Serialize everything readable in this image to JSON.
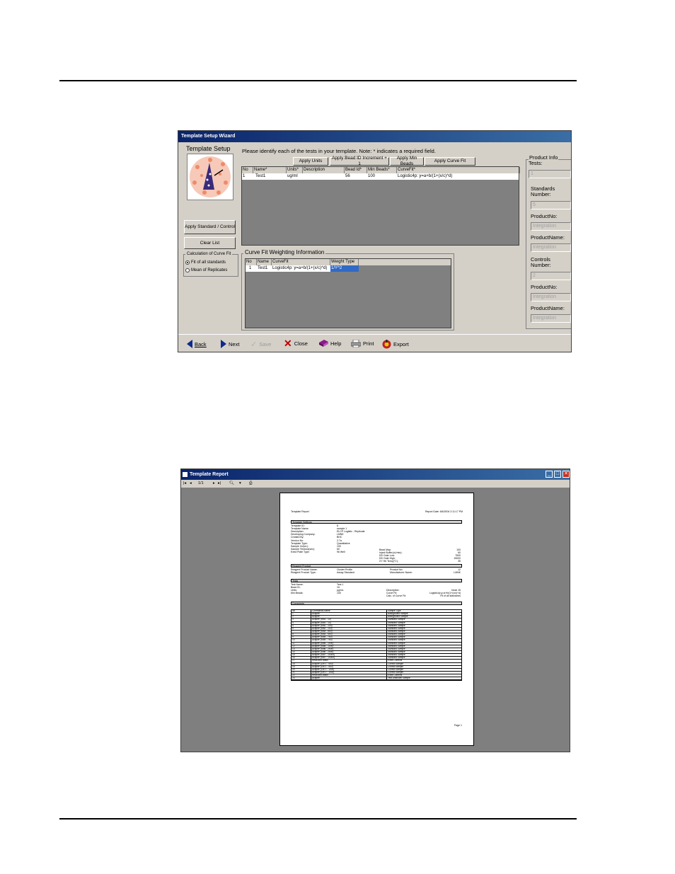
{
  "wizard": {
    "title": "Template Setup Wizard",
    "heading": "Template Setup",
    "instructions": "Please identify each of the tests in your template.  Note: * indicates a required field.",
    "buttons": {
      "apply_units": "Apply Units",
      "apply_bead_id": "Apply Bead ID Increment + 1",
      "apply_min_beads": "Apply Min Beads",
      "apply_curve_fit": "Apply Curve Fit",
      "apply_standard": "Apply Standard / Control",
      "clear_list": "Clear List"
    },
    "calc_group": {
      "label": "Calculation of Curve Fit",
      "options": [
        "Fit of all standards",
        "Mean of Replicates"
      ],
      "selected": "Fit of all standards"
    },
    "tests_grid": {
      "columns": [
        "No",
        "Name*",
        "Units*",
        "Description",
        "Bead Id*",
        "Min Beads*",
        "CurveFit*"
      ],
      "rows": [
        [
          "1",
          "Test1",
          "ug/ml",
          "",
          "56",
          "100",
          "Logistic4p: y=a+b/(1+(x/c)^d)"
        ]
      ]
    },
    "weighting": {
      "label": "Curve Fit Weighting Information",
      "columns": [
        "No",
        "Name",
        "CurveFit",
        "Weight Type"
      ],
      "rows": [
        [
          "1",
          "Test1",
          "Logistic4p: y=a+b/(1+(x/c)^d)",
          "1/Y^2"
        ]
      ]
    },
    "product_info": {
      "label": "Product Info",
      "tests_label": "Tests:",
      "tests_value": "1",
      "standards_label": "Standards Number:",
      "standards_value": "5",
      "product_no_label": "ProductNo:",
      "product_no_value": "Integration",
      "product_name_label": "ProductName:",
      "product_name_value": "Integration",
      "controls_label": "Controls Number:",
      "controls_value": "2",
      "controls_product_no_label": "ProductNo:",
      "controls_product_no_value": "Integration",
      "controls_product_name_label": "ProductName:",
      "controls_product_name_value": "Integration"
    },
    "toolbar": {
      "back": "Back",
      "next": "Next",
      "save": "Save",
      "close": "Close",
      "help": "Help",
      "print": "Print",
      "export": "Export"
    }
  },
  "report": {
    "title": "Template Report",
    "toolbar": {
      "page_indicator": "1/1"
    },
    "page": {
      "header_left": "Template Report",
      "header_right": "Report Date: 6/6/2004 2:11:17 PM",
      "settings_bar": "Template Settings",
      "settings_left": [
        [
          "Template ID:",
          "8"
        ],
        [
          "Template Name:",
          "sample 1"
        ],
        [
          "Description:",
          "ELCP Logistic - Replicate"
        ],
        [
          "Developing Company:",
          "LMNK"
        ],
        [
          "Created By:",
          "BHC"
        ],
        [
          "Version No:",
          "2.7a"
        ],
        [
          "Template Type:",
          "Quantitative"
        ],
        [
          "Sample Vol(uL):",
          "100"
        ],
        [
          "Sample Timeout(sec):",
          "60"
        ],
        [
          "Extra Plate Type:",
          "96 Well"
        ]
      ],
      "settings_right": [
        [
          "Bead Map:",
          "100"
        ],
        [
          "Inject Buffer(uL/min):",
          "60"
        ],
        [
          "DD Gate Low:",
          "7500"
        ],
        [
          "DD Gate High:",
          "15000"
        ],
        [
          "XY Htr Temp(°C):",
          "35"
        ]
      ],
      "reagent_bar": "Reagent Product",
      "reagent_left": [
        [
          "Reagent Product Name:",
          "Cluster Profile"
        ],
        [
          "Reagent Product Type:",
          "Assay Standard"
        ]
      ],
      "reagent_right": [
        [
          "Product No:",
          "12"
        ],
        [
          "Manufacturer Name:",
          "LMNK"
        ]
      ],
      "tests_bar": "Tests",
      "tests_left": [
        [
          "Test Name:",
          "Test 1"
        ],
        [
          "Bead ID:",
          "15"
        ],
        [
          "Units:",
          "pg/mL"
        ],
        [
          "Min Beads:",
          "100"
        ]
      ],
      "tests_right": [
        [
          "Description:",
          "bead 15"
        ],
        [
          "Curve Fit:",
          "Logistic4p:y=a+b/(1+(x/c)^d)"
        ],
        [
          "Calc. of Curve Fit:",
          "Fit of all standards"
        ]
      ],
      "comments_bar": "Comments",
      "table_header": [
        "No",
        "Commands Name",
        "Sample Type"
      ],
      "table_rows": [
        [
          "1",
          "Acquire",
          "Background Sample"
        ],
        [
          "2",
          "Acquire",
          "Background Sample"
        ],
        [
          "3",
          "Acquire (Std1 - 10)",
          "Standard Sample"
        ],
        [
          "4",
          "Acquire (Std1 - 10)",
          "Standard Sample"
        ],
        [
          "5",
          "Acquire (Std2 - 100)",
          "Standard Sample"
        ],
        [
          "6",
          "Acquire (Std2 - 100)",
          "Standard Sample"
        ],
        [
          "7",
          "Acquire (Std3 - 500)",
          "Standard Sample"
        ],
        [
          "8",
          "Acquire (Std3 - 500)",
          "Standard Sample"
        ],
        [
          "9",
          "Acquire (Std4 - 750)",
          "Standard Sample"
        ],
        [
          "10",
          "Acquire (Std4 - 750)",
          "Standard Sample"
        ],
        [
          "11",
          "Acquire (Std5 - 1000)",
          "Standard Sample"
        ],
        [
          "12",
          "Acquire (Std5 - 1000)",
          "Standard Sample"
        ],
        [
          "13",
          "Acquire (Std6 - 2500)",
          "Standard Sample"
        ],
        [
          "14",
          "Acquire (Std6 - 2500)",
          "Standard Sample"
        ],
        [
          "15",
          "Acquire (Std7 - 10000)",
          "Standard Sample"
        ],
        [
          "16",
          "Acquire (Std7 - 10000)",
          "Standard Sample"
        ],
        [
          "17",
          "Read and Wash",
          "Extra Controls"
        ],
        [
          "18",
          "Acquire (Ctrl 1 - 500)",
          "Control Sample"
        ],
        [
          "19",
          "Acquire (Ctrl 1 - 500)",
          "Control Sample"
        ],
        [
          "20",
          "Acquire (Ctrl 2 - 1000)",
          "Control Sample"
        ],
        [
          "21",
          "Acquire (Ctrl 2 - 1000)",
          "Control Sample"
        ],
        [
          "22",
          "Read and Wash",
          "Extra Controls"
        ],
        [
          "23",
          "Acquire",
          "Test Unknown Sample"
        ]
      ],
      "footer": "Page 1"
    }
  }
}
